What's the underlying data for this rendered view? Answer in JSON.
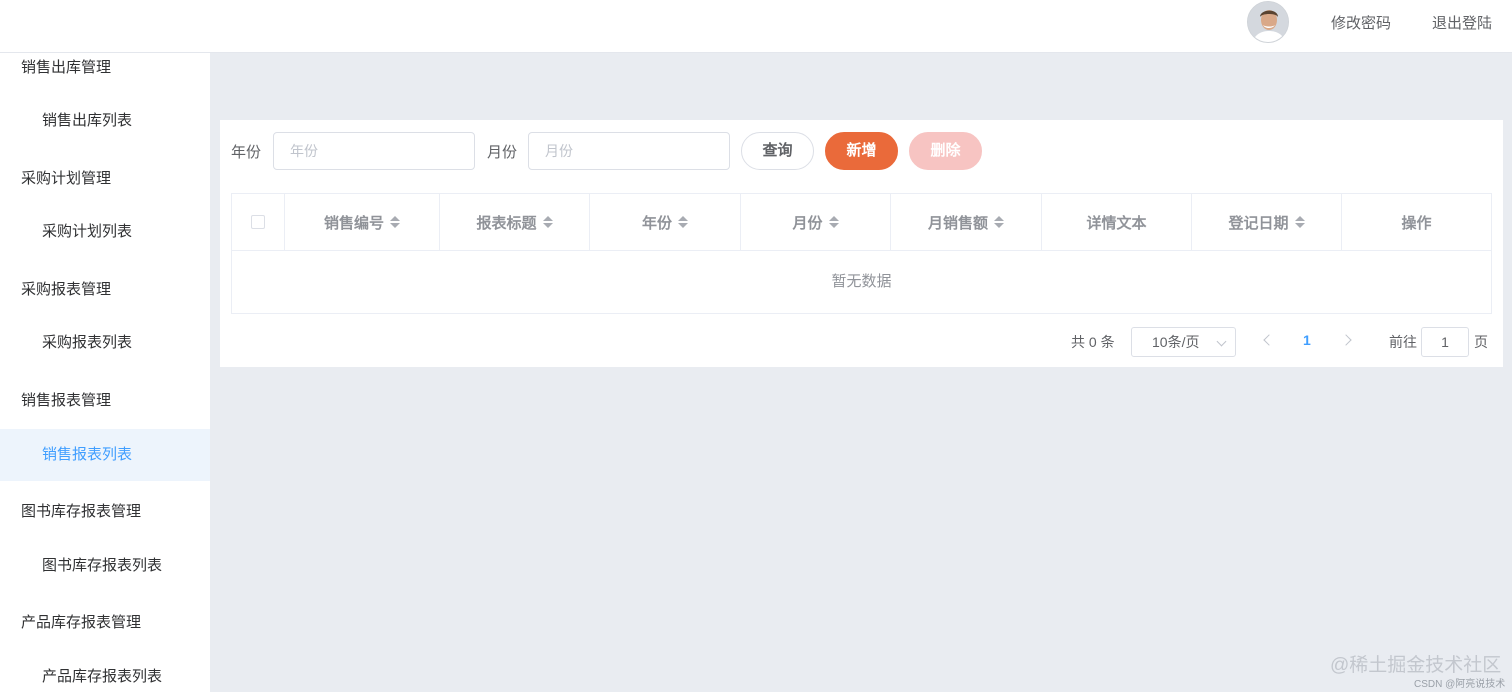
{
  "header": {
    "change_password": "修改密码",
    "logout": "退出登陆"
  },
  "sidebar": {
    "items": [
      {
        "label": "销售出库管理",
        "type": "group"
      },
      {
        "label": "销售出库列表",
        "type": "item"
      },
      {
        "label": "采购计划管理",
        "type": "group"
      },
      {
        "label": "采购计划列表",
        "type": "item"
      },
      {
        "label": "采购报表管理",
        "type": "group"
      },
      {
        "label": "采购报表列表",
        "type": "item"
      },
      {
        "label": "销售报表管理",
        "type": "group"
      },
      {
        "label": "销售报表列表",
        "type": "item",
        "active": true
      },
      {
        "label": "图书库存报表管理",
        "type": "group"
      },
      {
        "label": "图书库存报表列表",
        "type": "item"
      },
      {
        "label": "产品库存报表管理",
        "type": "group"
      },
      {
        "label": "产品库存报表列表",
        "type": "item"
      }
    ]
  },
  "search": {
    "year_label": "年份",
    "year_placeholder": "年份",
    "month_label": "月份",
    "month_placeholder": "月份",
    "query_button": "查询",
    "add_button": "新增",
    "delete_button": "删除"
  },
  "table": {
    "columns": [
      "销售编号",
      "报表标题",
      "年份",
      "月份",
      "月销售额",
      "详情文本",
      "登记日期",
      "操作"
    ],
    "sortable": [
      true,
      true,
      true,
      true,
      true,
      false,
      true,
      false
    ],
    "empty_text": "暂无数据"
  },
  "pagination": {
    "total": "共 0 条",
    "page_size": "10条/页",
    "current_page": "1",
    "goto_label": "前往",
    "goto_value": "1",
    "page_unit": "页"
  },
  "watermark": {
    "main": "@稀土掘金技术社区",
    "sub": "CSDN @阿亮说技术"
  },
  "colors": {
    "accent": "#409eff",
    "add_button": "#ea6a3a",
    "delete_button_disabled": "#f7c4c2",
    "background": "#e9ecf1"
  }
}
